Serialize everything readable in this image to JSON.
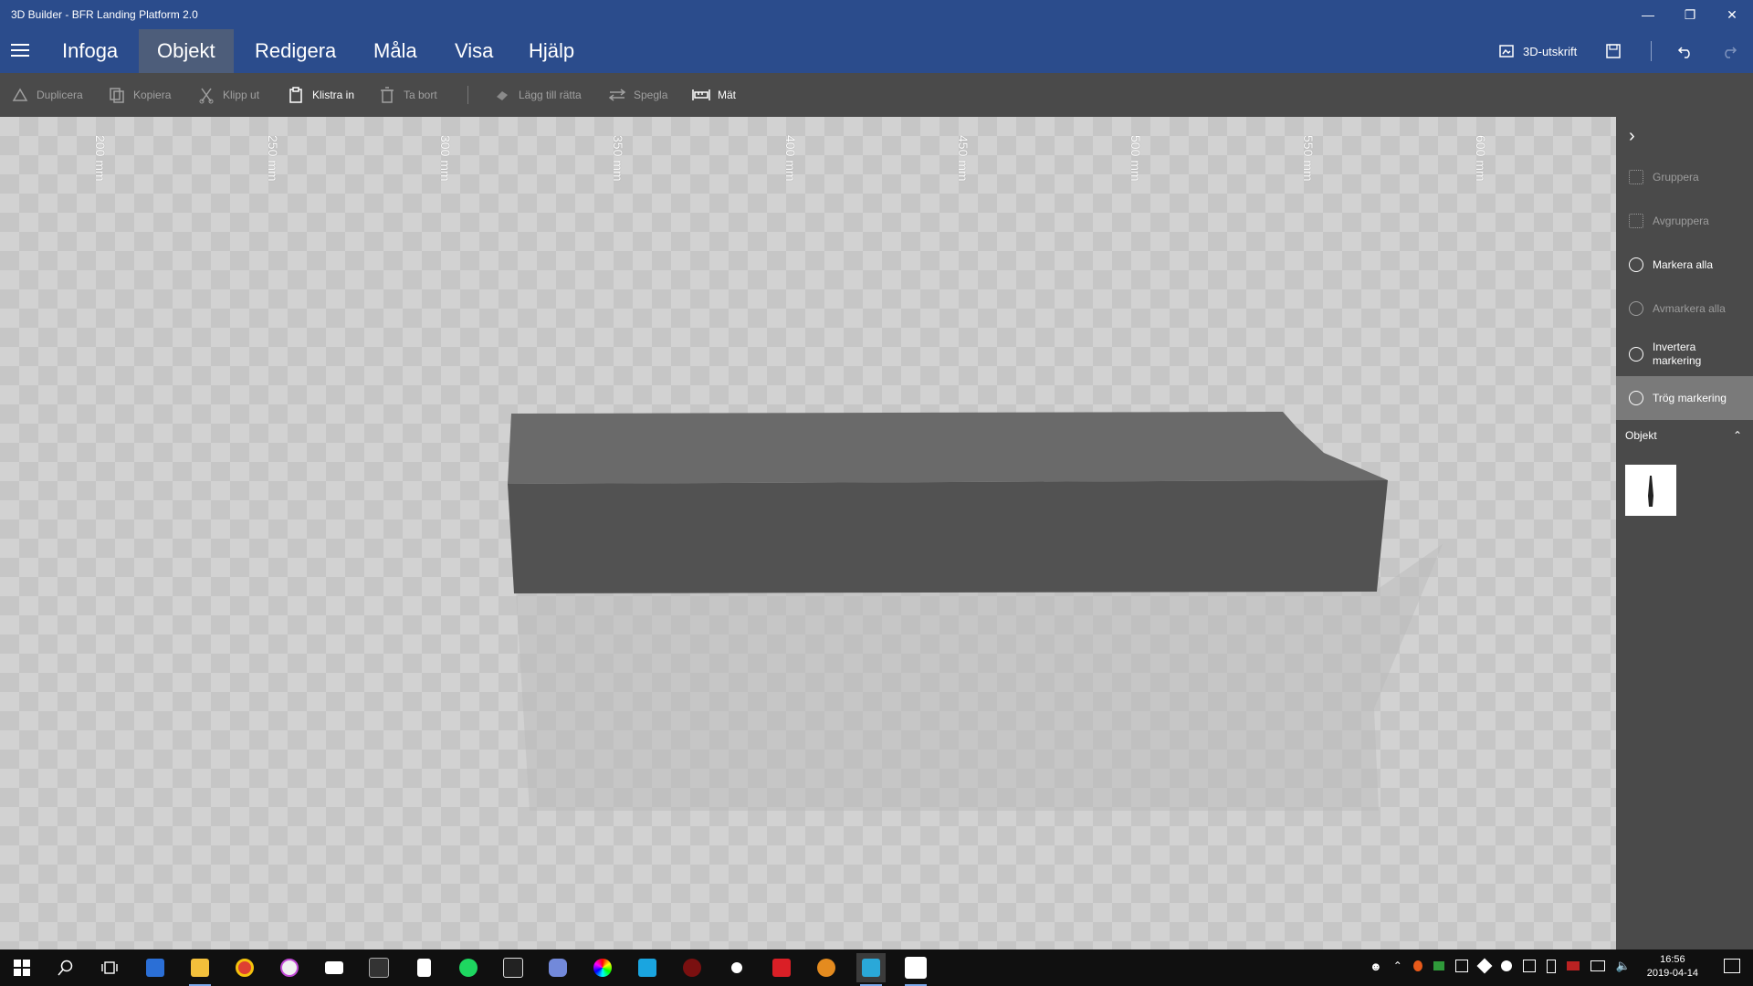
{
  "window": {
    "title": "3D Builder - BFR Landing Platform 2.0",
    "controls": [
      "minimize",
      "restore",
      "close"
    ]
  },
  "menu": {
    "tabs": [
      "Infoga",
      "Objekt",
      "Redigera",
      "Måla",
      "Visa",
      "Hjälp"
    ],
    "active_tab": "Objekt",
    "print_label": "3D-utskrift"
  },
  "toolbar": {
    "items": [
      {
        "label": "Duplicera",
        "icon": "duplicate-icon",
        "enabled": false
      },
      {
        "label": "Kopiera",
        "icon": "copy-icon",
        "enabled": false
      },
      {
        "label": "Klipp ut",
        "icon": "cut-icon",
        "enabled": false
      },
      {
        "label": "Klistra in",
        "icon": "paste-icon",
        "enabled": true
      },
      {
        "label": "Ta bort",
        "icon": "delete-icon",
        "enabled": false
      },
      {
        "label": "Lägg till rätta",
        "icon": "settle-icon",
        "enabled": false
      },
      {
        "label": "Spegla",
        "icon": "mirror-icon",
        "enabled": false
      },
      {
        "label": "Mät",
        "icon": "measure-icon",
        "enabled": true
      }
    ]
  },
  "viewport": {
    "ruler_labels": [
      "200 mm",
      "250 mm",
      "300 mm",
      "350 mm",
      "400 mm",
      "450 mm",
      "500 mm",
      "550 mm",
      "600 mm"
    ],
    "object_color": "#5a5a5a"
  },
  "right_panel": {
    "items": [
      {
        "label": "Gruppera",
        "enabled": false
      },
      {
        "label": "Avgruppera",
        "enabled": false
      },
      {
        "label": "Markera alla",
        "enabled": true
      },
      {
        "label": "Avmarkera alla",
        "enabled": false
      },
      {
        "label": "Invertera markering",
        "enabled": true
      },
      {
        "label": "Trög markering",
        "enabled": true,
        "selected": true
      }
    ],
    "objects_header": "Objekt"
  },
  "taskbar": {
    "apps": [
      "start",
      "search",
      "task-view",
      "store",
      "file-explorer",
      "chrome",
      "itunes",
      "mail",
      "ssd-tool",
      "notepad",
      "spotify",
      "epic-games",
      "discord",
      "razer",
      "ccleaner",
      "msi-afterburner",
      "steam",
      "creative-cloud",
      "chrome-canary",
      "3d-builder",
      "photos"
    ],
    "clock_time": "16:56",
    "clock_date": "2019-04-14"
  },
  "colors": {
    "titlebar": "#2b4c8c",
    "toolbar": "#4a4a4a",
    "viewport_light": "#d2d2d2",
    "viewport_dark": "#c6c6c6"
  }
}
